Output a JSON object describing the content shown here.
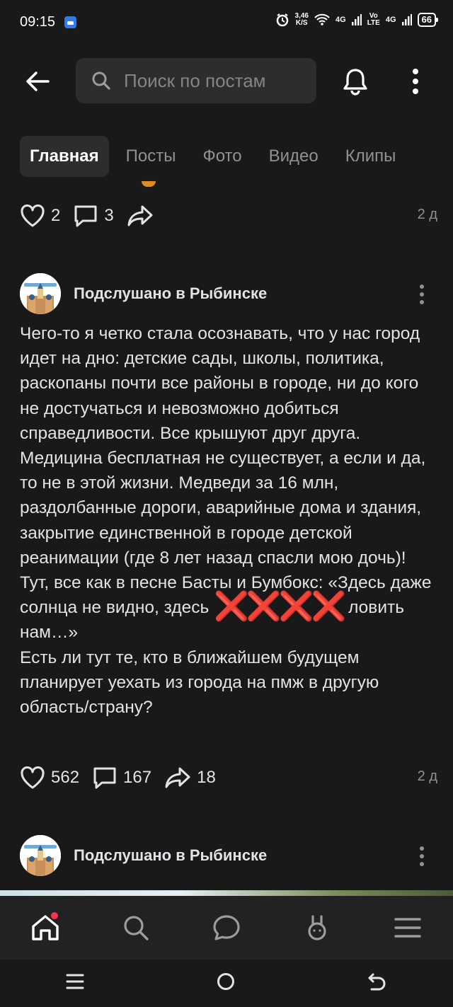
{
  "status": {
    "time": "09:15",
    "speed_value": "3,46",
    "speed_unit": "K/S",
    "net1": "4G",
    "net2_top": "Vo",
    "net2_bottom": "LTE",
    "net3": "4G",
    "battery": "66"
  },
  "header": {
    "search_placeholder": "Поиск по постам"
  },
  "tabs": [
    {
      "label": "Главная",
      "active": true
    },
    {
      "label": "Посты",
      "active": false
    },
    {
      "label": "Фото",
      "active": false
    },
    {
      "label": "Видео",
      "active": false
    },
    {
      "label": "Клипы",
      "active": false
    }
  ],
  "prev_post": {
    "likes": "2",
    "comments": "3",
    "time": "2 д"
  },
  "post": {
    "author": "Подслушано в Рыбинске",
    "text_part1": "Чего-то я четко стала осознавать, что у нас город идет на дно: детские сады, школы, политика, раскопаны почти все районы в городе, ни до кого не достучаться и невозможно добиться справедливости. Все крышуют друг друга. Медицина бесплатная не существует, а если и да, то не в этой жизни. Медведи за 16 млн, раздолбанные дороги, аварийные дома и здания, закрытие единственной в городе детской реанимации (где 8 лет назад спасли мою дочь)!",
    "text_part2_before": "Тут, все как в песне Басты и Бумбокс: «Здесь даже солнца не видно, здесь ",
    "censor": "❌❌❌❌",
    "text_part2_after": " ловить нам…»",
    "text_part3": "Есть ли тут те, кто в ближайшем будущем планирует уехать из города на пмж в другую область/страну?",
    "likes": "562",
    "comments": "167",
    "shares": "18",
    "time": "2 д"
  },
  "next_post": {
    "author": "Подслушано в Рыбинске"
  },
  "colors": {
    "background": "#191919",
    "accent": "#2a7df5",
    "badge": "#ff3347",
    "censor": "#e02020"
  }
}
